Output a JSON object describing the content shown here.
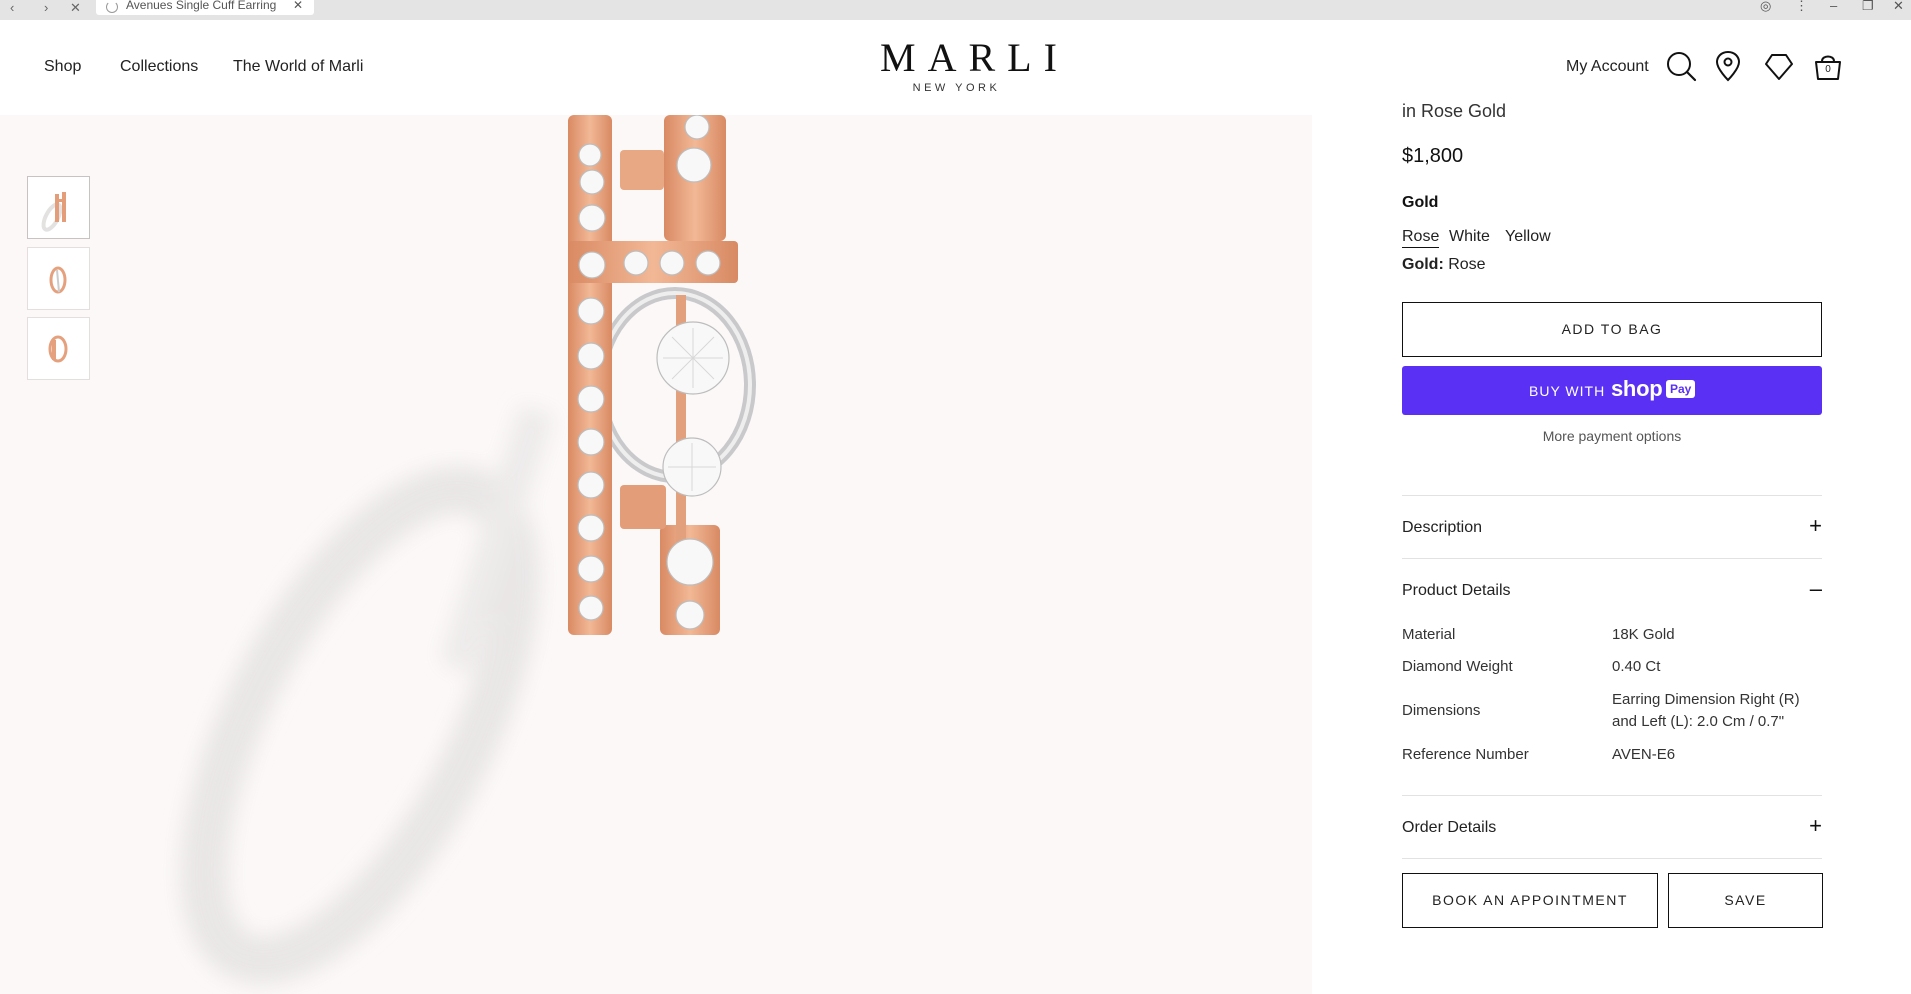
{
  "browser": {
    "tab_title": "Avenues Single Cuff Earring"
  },
  "header": {
    "nav": [
      "Shop",
      "Collections",
      "The World of Marli"
    ],
    "logo": "MARLI",
    "logo_sub": "NEW YORK",
    "account": "My Account",
    "bag_count": "0"
  },
  "gallery": {
    "thumbnail_count": 3,
    "active_index": 0
  },
  "product": {
    "subtitle": "in Rose Gold",
    "price": "$1,800",
    "option_title": "Gold",
    "options": [
      "Rose",
      "White",
      "Yellow"
    ],
    "selected_label": "Gold:",
    "selected_value": "Rose",
    "add_to_bag": "ADD TO BAG",
    "buy_with": "BUY WITH",
    "shop_word": "shop",
    "pay_word": "Pay",
    "more_payment": "More payment options"
  },
  "accordions": {
    "description": {
      "label": "Description",
      "sign": "+"
    },
    "product_details": {
      "label": "Product Details",
      "sign": "–"
    },
    "order_details": {
      "label": "Order Details",
      "sign": "+"
    }
  },
  "specs": [
    {
      "label": "Material",
      "value": "18K Gold"
    },
    {
      "label": "Diamond Weight",
      "value": "0.40 Ct"
    },
    {
      "label": "Dimensions",
      "value": "Earring Dimension Right (R) and Left (L): 2.0 Cm / 0.7\""
    },
    {
      "label": "Reference Number",
      "value": "AVEN-E6"
    }
  ],
  "actions": {
    "book": "BOOK AN APPOINTMENT",
    "save": "SAVE"
  },
  "colors": {
    "shop_pay": "#5a31f4",
    "gallery_bg": "#fcf8f8",
    "rose_gold": "#e8a07c"
  }
}
